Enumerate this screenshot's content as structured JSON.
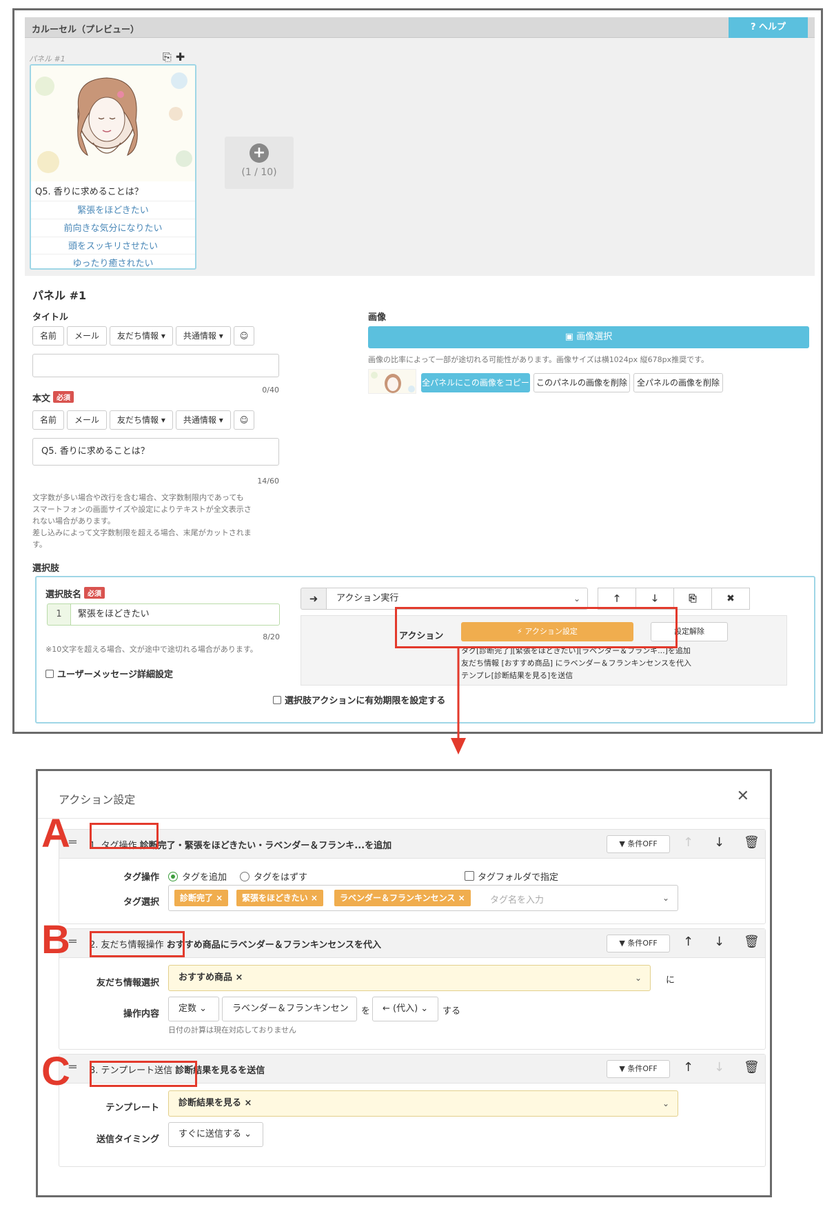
{
  "carousel": {
    "header_title": "カルーセル（プレビュー）",
    "help_label": "? ヘルプ",
    "panel_label": "パネル #1",
    "card_title": "Q5. 香りに求めることは？",
    "card_choices": [
      "緊張をほどきたい",
      "前向きな気分になりたい",
      "頭をスッキリさせたい",
      "ゆったり癒されたい"
    ],
    "panel_count": "(1 / 10)"
  },
  "editor": {
    "panel_heading": "パネル #1",
    "title_label": "タイトル",
    "insert_buttons": [
      "名前",
      "メール",
      "友だち情報 ▾",
      "共通情報 ▾"
    ],
    "title_value": "",
    "title_counter": "0/40",
    "body_label": "本文",
    "required_badge": "必須",
    "body_value": "Q5. 香りに求めることは？",
    "body_counter": "14/60",
    "body_note": [
      "文字数が多い場合や改行を含む場合、文字数制限内であっても",
      "スマートフォンの画面サイズや設定によりテキストが全文表示さ",
      "れない場合があります。",
      "差し込みによって文字数制限を超える場合、末尾がカットされま",
      "す。"
    ],
    "image_label": "画像",
    "image_select": "画像選択",
    "image_note": "画像の比率によって一部が途切れる可能性があります。画像サイズは横1024px 縦678px推奨です。",
    "image_buttons": [
      "全パネルにこの画像をコピー",
      "このパネルの画像を削除",
      "全パネルの画像を削除"
    ],
    "choices_label": "選択肢",
    "choice_name_label": "選択肢名",
    "choice_index": "1",
    "choice_value": "緊張をほどきたい",
    "choice_counter": "8/20",
    "choice_note": "※10文字を超える場合、文が途中で途切れる場合があります。",
    "user_message_check": "ユーザーメッセージ詳細設定",
    "action_type": "アクション実行",
    "action_label": "アクション",
    "action_button": "アクション設定",
    "reset_button": "設定解除",
    "action_desc": [
      "タグ[診断完了][緊張をほどきたい][ラベンダー＆フランキ...]を追加",
      "友だち情報 [おすすめ商品] にラベンダー＆フランキンセンスを代入",
      "テンプレ[診断結果を見る]を送信"
    ],
    "expiry_check": "選択肢アクションに有効期限を設定する"
  },
  "modal": {
    "title": "アクション設定",
    "cond_label": "条件OFF",
    "steps": [
      {
        "letter": "A",
        "name": "1. タグ操作",
        "summary": "診断完了・緊張をほどきたい・ラベンダー＆フランキ...を追加",
        "op_label": "タグ操作",
        "op_add": "タグを追加",
        "op_remove": "タグをはずす",
        "folder_check": "タグフォルダで指定",
        "select_label": "タグ選択",
        "tags": [
          "診断完了 ×",
          "緊張をほどきたい ×",
          "ラベンダー＆フランキンセンス ×"
        ],
        "tag_placeholder": "タグ名を入力"
      },
      {
        "letter": "B",
        "name": "2. 友だち情報操作",
        "summary": "おすすめ商品にラベンダー＆フランキンセンスを代入",
        "select_label": "友だち情報選択",
        "select_value": "おすすめ商品 ×",
        "ni": "に",
        "op_label": "操作内容",
        "op_type": "定数",
        "op_value": "ラベンダー＆フランキンセン",
        "wo": "を",
        "op_mode": "← (代入)",
        "suru": "する",
        "note": "日付の計算は現在対応しておりません"
      },
      {
        "letter": "C",
        "name": "3. テンプレート送信",
        "summary": "診断結果を見るを送信",
        "tpl_label": "テンプレート",
        "tpl_value": "診断結果を見る ×",
        "timing_label": "送信タイミング",
        "timing_value": "すぐに送信する"
      }
    ]
  },
  "colors": {
    "accent_info": "#5bc0de",
    "accent_warning": "#f0ad4e",
    "highlight_red": "#e33a2c"
  }
}
